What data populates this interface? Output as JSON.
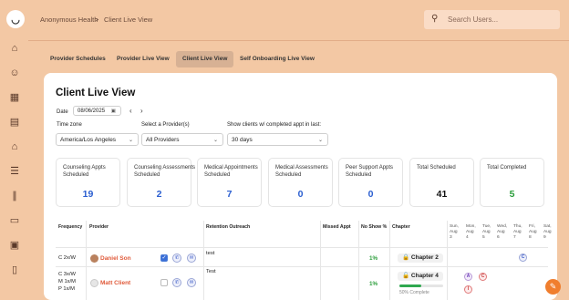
{
  "breadcrumb": {
    "root": "Anonymous Health",
    "separator": ">",
    "current": "Client Live View"
  },
  "search": {
    "placeholder": "Search Users..."
  },
  "tabs": [
    {
      "label": "Provider Schedules"
    },
    {
      "label": "Provider Live View"
    },
    {
      "label": "Client Live View",
      "active": true
    },
    {
      "label": "Self Onboarding Live View"
    }
  ],
  "page": {
    "title": "Client Live View",
    "date_label": "Date",
    "date_value": "08/06/2025",
    "timezone_label": "Time zone",
    "timezone_value": "America/Los Angeles",
    "provider_label": "Select a Provider(s)",
    "provider_value": "All Providers",
    "completed_label": "Show clients w/ completed appt in last:",
    "completed_value": "30 days"
  },
  "stats": [
    {
      "label": "Counseling Appts Scheduled",
      "value": "19",
      "color": "#2a5ed0"
    },
    {
      "label": "Counseling Assessments Scheduled",
      "value": "2",
      "color": "#2a5ed0"
    },
    {
      "label": "Medical Appointments Scheduled",
      "value": "7",
      "color": "#2a5ed0"
    },
    {
      "label": "Medical Assessments Scheduled",
      "value": "0",
      "color": "#2a5ed0"
    },
    {
      "label": "Peer Support Appts Scheduled",
      "value": "0",
      "color": "#2a5ed0"
    },
    {
      "label": "Total Scheduled",
      "value": "41",
      "color": "#111111"
    },
    {
      "label": "Total Completed",
      "value": "5",
      "color": "#2a9d3a"
    }
  ],
  "table": {
    "headers": {
      "frequency": "Frequency",
      "provider": "Provider",
      "retention": "Retention Outreach",
      "missed": "Missed Appt",
      "noshow": "No Show %",
      "chapter": "Chapter"
    },
    "days": [
      {
        "d": "Sun,",
        "m": "Aug",
        "n": "3"
      },
      {
        "d": "Mon,",
        "m": "Aug",
        "n": "4"
      },
      {
        "d": "Tue,",
        "m": "Aug",
        "n": "5"
      },
      {
        "d": "Wed,",
        "m": "Aug",
        "n": "6"
      },
      {
        "d": "Thu,",
        "m": "Aug",
        "n": "7"
      },
      {
        "d": "Fri,",
        "m": "Aug",
        "n": "8"
      },
      {
        "d": "Sat,",
        "m": "Aug",
        "n": "9"
      }
    ],
    "rows": [
      {
        "frequency": [
          "C 2x/W"
        ],
        "provider": "Daniel Son",
        "note": "test",
        "noshow": "1%",
        "chapter": "Chapter 2",
        "checked": true
      },
      {
        "frequency": [
          "C 3x/W",
          "M 1x/M",
          "P 1x/M"
        ],
        "provider": "Matt Client",
        "note": "Test",
        "noshow": "1%",
        "chapter": "Chapter 4",
        "progress_text": "50% Complete",
        "progress": 0.5,
        "checked": false
      }
    ],
    "day_markers": {
      "row1_thu": "C",
      "row2_mon_a": "A",
      "row2_tue": "C",
      "row2_mon_i": "I"
    }
  }
}
